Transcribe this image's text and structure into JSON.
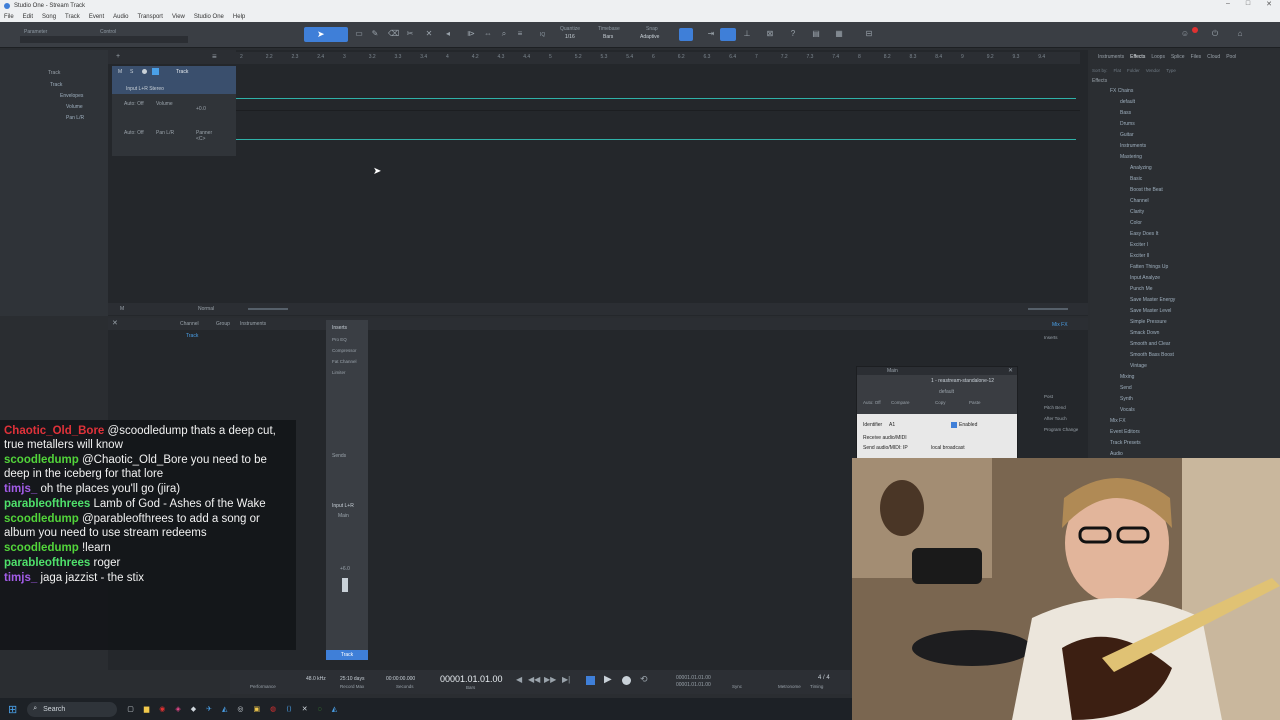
{
  "window": {
    "title": "Studio One - Stream Track"
  },
  "menu": [
    "File",
    "Edit",
    "Song",
    "Track",
    "Event",
    "Audio",
    "Transport",
    "View",
    "Studio One",
    "Help"
  ],
  "toolbar": {
    "parameter_label": "Parameter",
    "control_label": "Control",
    "quantize_label": "Quantize",
    "quantize_value": "1/16",
    "timebase_label": "Timebase",
    "timebase_value": "Bars",
    "snap_label": "Snap",
    "snap_value": "Adaptive",
    "iq_label": "IQ"
  },
  "inspector": {
    "track_label": "Track",
    "tree": [
      "Track",
      "Envelopes",
      "Volume",
      "Pan L/R"
    ]
  },
  "track": {
    "name": "Track",
    "input": "Input L+R Stereo",
    "auto_off": "Auto: Off",
    "volume_label": "Volume",
    "volume_value": "+0.0",
    "pan_label": "Pan L/R",
    "panner_label": "Panner",
    "pan_value": "<C>"
  },
  "ruler": [
    "2",
    "2.2",
    "2.3",
    "2.4",
    "3",
    "3.2",
    "3.3",
    "3.4",
    "4",
    "4.2",
    "4.3",
    "4.4",
    "5",
    "5.2",
    "5.3",
    "5.4",
    "6",
    "6.2",
    "6.3",
    "6.4",
    "7",
    "7.2",
    "7.3",
    "7.4",
    "8",
    "8.2",
    "8.3",
    "8.4",
    "9",
    "9.2",
    "9.3",
    "9.4"
  ],
  "browser": {
    "tabs": [
      "Instruments",
      "Effects",
      "Loops",
      "Splice",
      "Files",
      "Cloud",
      "Pool"
    ],
    "sort_row": [
      "Sort by:",
      "Flat",
      "Folder",
      "Vendor",
      "Type"
    ],
    "effects_label": "Effects",
    "tree": [
      "FX Chains",
      "default",
      "Bass",
      "Drums",
      "Guitar",
      "Instruments",
      "Mastering",
      "Analyzing",
      "Basic",
      "Boost the Beat",
      "Channel",
      "Clarity",
      "Color",
      "Easy Does It",
      "Exciter I",
      "Exciter II",
      "Fatten Things Up",
      "Input Analyze",
      "Punch Me",
      "Save Master Energy",
      "Save Master Level",
      "Simple Pressure",
      "Smack Down",
      "Smooth and Clear",
      "Smooth Bass Boost",
      "Vintage",
      "Mixing",
      "Send",
      "Synth",
      "Vocals",
      "Mix FX",
      "Event Editors",
      "Track Presets",
      "Audio"
    ]
  },
  "console": {
    "tabs": [
      "Channel",
      "Group",
      "Instruments"
    ],
    "track_item": "Track",
    "inserts_label": "Inserts",
    "inserts": [
      "Pro EQ",
      "Compressor",
      "Fat Channel",
      "Limiter"
    ],
    "sends_label": "Sends",
    "channel_input": "Input L+R",
    "channel_out": "Main",
    "channel_gain": "+6.0",
    "channel_name": "Track",
    "mixfx_label": "Mix FX",
    "right_items": [
      "Inserts",
      "Post",
      "Pitch Bend",
      "After Touch",
      "Program Change"
    ]
  },
  "plugin": {
    "title": "Main",
    "instance": "1 - reastream-standalone-12",
    "preset": "default",
    "auto_off": "Auto: Off",
    "compare": "Compare",
    "copy": "Copy",
    "paste": "Paste",
    "identifier_label": "Identifier",
    "identifier_value": "A1",
    "enabled_label": "Enabled",
    "receive_label": "Receive audio/MIDI",
    "send_label": "Send audio/MIDI: IP",
    "send_value": "local broadcast"
  },
  "chat": [
    {
      "user": "Chaotic_Old_Bore",
      "color": "#e0323a",
      "text": "@scoodledump thats a deep cut, true metallers will know"
    },
    {
      "user": "scoodledump",
      "color": "#52d43a",
      "text": "@Chaotic_Old_Bore you need to be deep in the iceberg for that lore"
    },
    {
      "user": "timjs_",
      "color": "#a35ce8",
      "text": "oh the places you'll go (jira)"
    },
    {
      "user": "parableofthrees",
      "color": "#4fe06b",
      "text": "Lamb of God - Ashes of the Wake"
    },
    {
      "user": "scoodledump",
      "color": "#52d43a",
      "text": "@parableofthrees to add a song or album you need to use stream redeems"
    },
    {
      "user": "scoodledump",
      "color": "#52d43a",
      "text": "!learn"
    },
    {
      "user": "parableofthrees",
      "color": "#4fe06b",
      "text": "roger"
    },
    {
      "user": "timjs_",
      "color": "#a35ce8",
      "text": "jaga jazzist - the stix"
    }
  ],
  "transport": {
    "sample_rate": "48.0 kHz",
    "record_time": "25:10 days",
    "record_max_label": "Record Max",
    "seconds": "00:00:00.000",
    "seconds_label": "Seconds",
    "position": "00001.01.01.00",
    "bars_label": "Bars",
    "loop_start": "00001.01.01.00",
    "loop_end": "00001.01.01.00",
    "signature": "4 / 4",
    "tempo": "120.00",
    "performance_label": "Performance",
    "sync_label": "Sync",
    "metronome_label": "Metronome",
    "timing_label": "Timing",
    "key_label": "Key",
    "tempo_label": "Tempo"
  },
  "taskbar": {
    "search_label": "Search"
  },
  "colors": {
    "accent": "#3f7fd8",
    "track_line": "#2fb1a8",
    "selected": "#4aa0e8"
  }
}
